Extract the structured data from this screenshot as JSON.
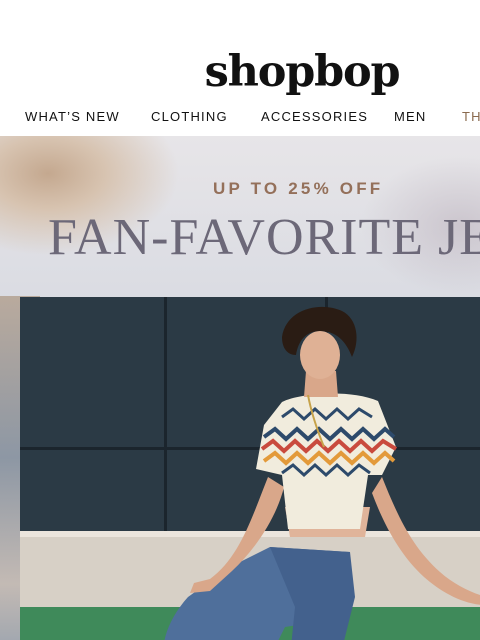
{
  "header": {
    "logo": "shopbop",
    "nav": [
      {
        "label": "WHAT’S NEW"
      },
      {
        "label": "CLOTHING"
      },
      {
        "label": "ACCESSORIES"
      },
      {
        "label": "MEN"
      },
      {
        "label": "TH"
      }
    ],
    "accent_color": "#8a6a4e"
  },
  "hero": {
    "promo": "UP TO 25% OFF",
    "headline": "FAN-FAVORITE JEA",
    "promo_color": "#94705a",
    "headline_color": "#6c6878"
  }
}
